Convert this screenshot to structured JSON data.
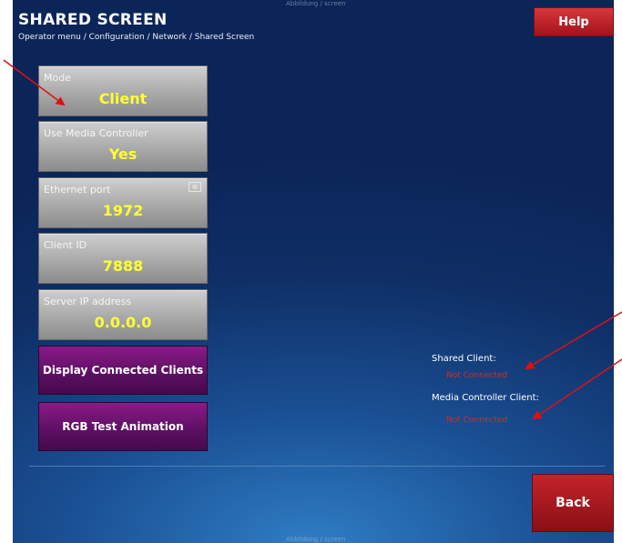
{
  "header": {
    "title": "SHARED SCREEN",
    "breadcrumb": "Operator menu / Configuration / Network / Shared Screen",
    "top_note": "Abbildung / screen"
  },
  "help_label": "Help",
  "settings": [
    {
      "label": "Mode",
      "value": "Client"
    },
    {
      "label": "Use Media Controller",
      "value": "Yes"
    },
    {
      "label": "Ethernet port",
      "value": "1972"
    },
    {
      "label": "Client ID",
      "value": "7888"
    },
    {
      "label": "Server IP address",
      "value": "0.0.0.0"
    }
  ],
  "actions": [
    {
      "label": "Display Connected Clients"
    },
    {
      "label": "RGB Test Animation"
    }
  ],
  "status": {
    "shared_client_label": "Shared Client:",
    "shared_client_value": "Not Connected",
    "media_controller_client_label": "Media Controller Client:",
    "media_controller_client_value": "Not Connected"
  },
  "back_label": "Back",
  "bottom_note": "Abbildung / screen",
  "colors": {
    "annotation_arrow": "#e01010",
    "value_text": "#ffff33",
    "button_red": "#b51a21",
    "button_purple": "#6a1371"
  }
}
